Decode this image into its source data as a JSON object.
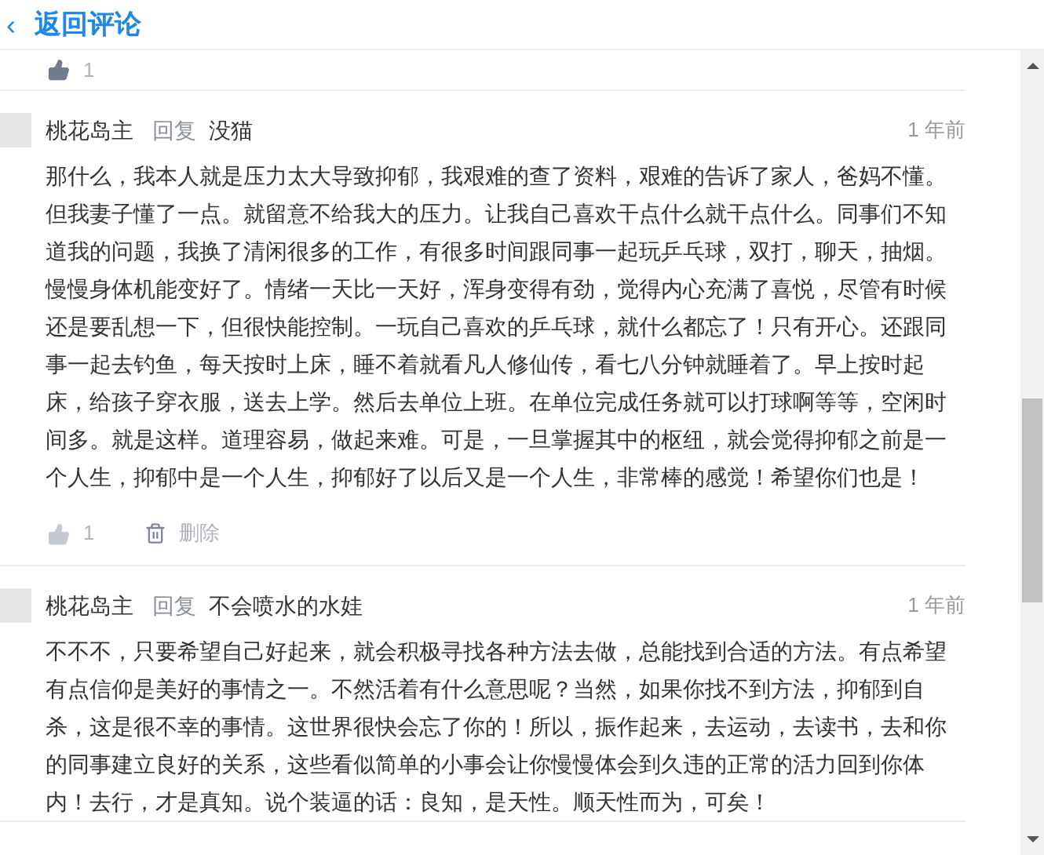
{
  "header": {
    "back_icon": "‹",
    "title": "返回评论"
  },
  "top_actions": {
    "likes": "1",
    "liked": true
  },
  "comments": [
    {
      "author": "桃花岛主",
      "reply_label": "回复",
      "reply_to": "没猫",
      "time": "1 年前",
      "body": "那什么，我本人就是压力太大导致抑郁，我艰难的查了资料，艰难的告诉了家人，爸妈不懂。但我妻子懂了一点。就留意不给我大的压力。让我自己喜欢干点什么就干点什么。同事们不知道我的问题，我换了清闲很多的工作，有很多时间跟同事一起玩乒乓球，双打，聊天，抽烟。慢慢身体机能变好了。情绪一天比一天好，浑身变得有劲，觉得内心充满了喜悦，尽管有时候还是要乱想一下，但很快能控制。一玩自己喜欢的乒乓球，就什么都忘了！只有开心。还跟同事一起去钓鱼，每天按时上床，睡不着就看凡人修仙传，看七八分钟就睡着了。早上按时起床，给孩子穿衣服，送去上学。然后去单位上班。在单位完成任务就可以打球啊等等，空闲时间多。就是这样。道理容易，做起来难。可是，一旦掌握其中的枢纽，就会觉得抑郁之前是一个人生，抑郁中是一个人生，抑郁好了以后又是一个人生，非常棒的感觉！希望你们也是！",
      "actions": {
        "likes": "1",
        "liked": false,
        "delete": "删除"
      }
    },
    {
      "author": "桃花岛主",
      "reply_label": "回复",
      "reply_to": "不会喷水的水娃",
      "time": "1 年前",
      "body": "不不不，只要希望自己好起来，就会积极寻找各种方法去做，总能找到合适的方法。有点希望有点信仰是美好的事情之一。不然活着有什么意思呢？当然，如果你找不到方法，抑郁到自杀，这是很不幸的事情。这世界很快会忘了你的！所以，振作起来，去运动，去读书，去和你的同事建立良好的关系，这些看似简单的小事会让你慢慢体会到久违的正常的活力回到你体内！去行，才是真知。说个装逼的话：良知，是天性。顺天性而为，可矣！"
    }
  ]
}
